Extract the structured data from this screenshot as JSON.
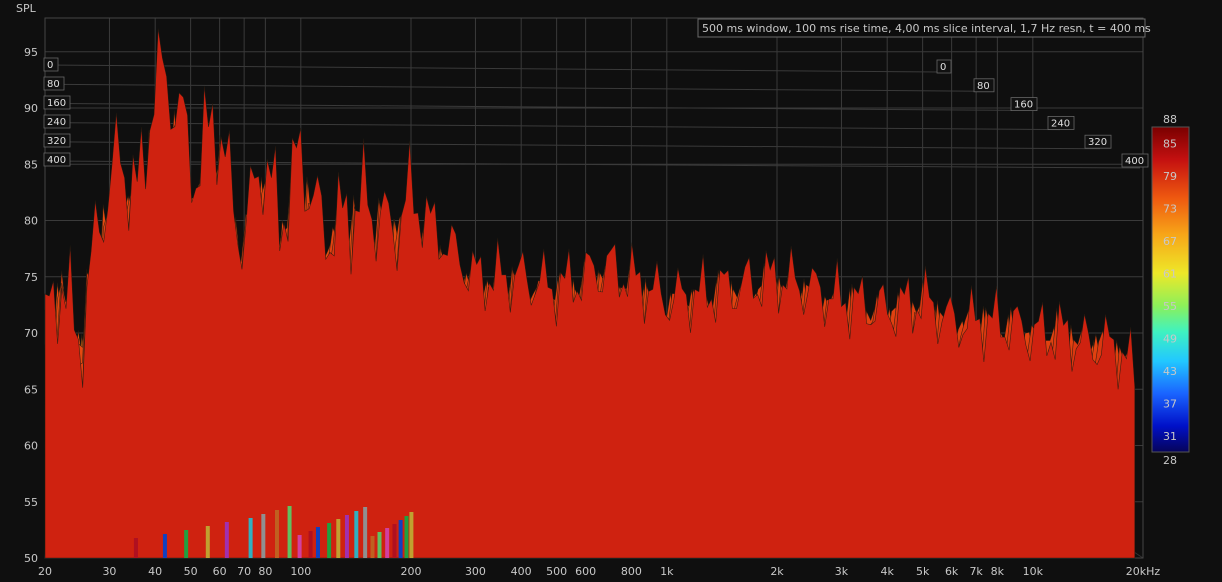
{
  "chart_data": {
    "type": "waterfall",
    "ylabel": "SPL",
    "info_label": "500 ms window, 100 ms rise time, 4,00 ms slice interval, 1,7 Hz resn, t = 400 ms",
    "x_ticks": [
      "20",
      "30",
      "40",
      "50",
      "60",
      "70",
      "80",
      "100",
      "200",
      "300",
      "400",
      "500",
      "600",
      "800",
      "1k",
      "2k",
      "3k",
      "4k",
      "5k",
      "6k",
      "7k",
      "8k",
      "10k",
      "20kHz"
    ],
    "x_tick_values": [
      20,
      30,
      40,
      50,
      60,
      70,
      80,
      100,
      200,
      300,
      400,
      500,
      600,
      800,
      1000,
      2000,
      3000,
      4000,
      5000,
      6000,
      7000,
      8000,
      10000,
      20000
    ],
    "xlim": [
      20,
      20000
    ],
    "x_scale": "log",
    "y_ticks": [
      50,
      55,
      60,
      65,
      70,
      75,
      80,
      85,
      90,
      95
    ],
    "ylim": [
      50,
      98
    ],
    "time_ticks": [
      "0",
      "80",
      "160",
      "240",
      "320",
      "400"
    ],
    "time_range_ms": [
      0,
      400
    ],
    "colorbar": {
      "ticks": [
        "88",
        "85",
        "79",
        "73",
        "67",
        "61",
        "55",
        "49",
        "43",
        "37",
        "31",
        "28"
      ],
      "range": [
        28,
        88
      ]
    },
    "surface_profile": {
      "freq_hz": [
        20,
        22,
        25,
        28,
        32,
        36,
        40,
        44,
        48,
        52,
        58,
        64,
        70,
        78,
        88,
        100,
        115,
        130,
        150,
        175,
        200,
        250,
        300,
        400,
        500,
        700,
        1000,
        1500,
        2000,
        3000,
        4000,
        5000,
        6000,
        8000,
        10000,
        12000,
        14000,
        16000,
        18000,
        19000
      ],
      "peak_spl_at_t0": [
        70,
        75,
        69,
        80,
        86,
        82,
        93,
        92,
        88,
        84,
        90,
        83,
        78,
        86,
        80,
        86,
        79,
        80,
        82,
        79,
        82,
        78,
        75,
        75,
        74,
        76,
        73,
        74,
        75,
        73,
        72,
        73,
        71,
        71,
        70,
        70,
        69,
        69,
        68,
        66
      ],
      "floor_spl_at_t400": [
        52,
        54,
        51,
        53,
        55,
        52,
        54,
        53,
        52,
        54,
        52,
        53,
        54,
        53,
        52,
        54,
        55,
        54,
        55,
        56,
        55,
        55,
        56,
        56,
        57,
        56,
        56,
        57,
        56,
        57,
        56,
        57,
        56,
        57,
        56,
        56,
        56,
        56,
        55,
        55
      ]
    },
    "grid": true,
    "legend": "right"
  }
}
